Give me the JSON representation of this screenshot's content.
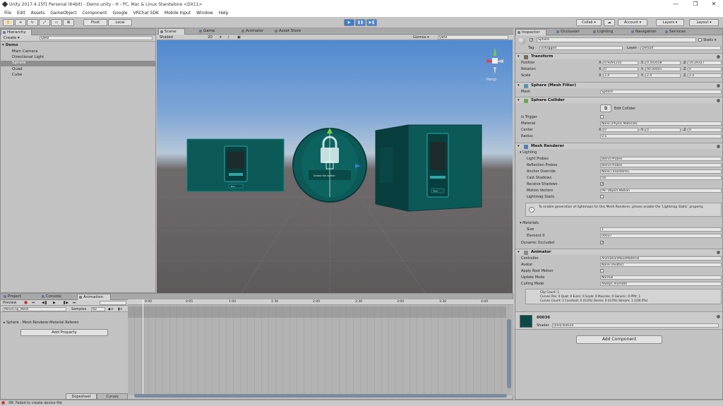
{
  "window": {
    "title": "Unity 2017.4.15f1 Personal (64bit) - Demo.unity - H - PC, Mac & Linux Standalone <DX11>",
    "controls": [
      "—",
      "❐",
      "✕"
    ]
  },
  "menu": [
    "File",
    "Edit",
    "Assets",
    "GameObject",
    "Component",
    "Google",
    "VRChat SDK",
    "Mobile Input",
    "Window",
    "Help"
  ],
  "toolbar": {
    "pivot": "Pivot",
    "local": "Local",
    "collab": "Collab ▾",
    "account": "Account ▾",
    "layers": "Layers ▾",
    "layout": "Layout ▾",
    "play_active": true,
    "accent": "#3d7bd4"
  },
  "hierarchy": {
    "tab": "Hierarchy",
    "create": "Create ▾",
    "search": "Q▾All",
    "scene_name": "Demo",
    "items": [
      "Main Camera",
      "Directional Light",
      "Sphere",
      "Quad",
      "Cube"
    ],
    "selected": "Sphere"
  },
  "scene_tabs": [
    "Scene",
    "Game",
    "Animator",
    "Asset Store"
  ],
  "scene_bar": {
    "shading": "Shaded",
    "mode": "2D",
    "gizmos": "Gizmos ▾",
    "search": "Q▾All",
    "persp": "Persp"
  },
  "scene_objects": {
    "panel_button": "Run",
    "screen_text": "Unlock the screen",
    "colors": {
      "teal": "#0b5a58",
      "teal_dark": "#083f3e",
      "glow": "#32c7c7"
    }
  },
  "bottom_tabs": [
    "Project",
    "Console",
    "Animation"
  ],
  "animation": {
    "preview": "Preview",
    "clip": "MoveClip_Mesh",
    "samples_label": "Samples",
    "samples": "60",
    "property": "Sphere : Mesh Renderer.Material Referen",
    "add_property": "Add Property",
    "ticks": [
      "0:00",
      "0:05",
      "1:00",
      "1:30",
      "2:00",
      "2:30",
      "3:00",
      "3:30",
      "4:00"
    ],
    "footer_tabs": [
      "Dopesheet",
      "Curves"
    ]
  },
  "status": {
    "message": "XR: Failed to create device file"
  },
  "inspector": {
    "tabs": [
      "Inspector",
      "Occlusion",
      "Lighting",
      "Navigation",
      "Services"
    ],
    "object_name": "Sphere",
    "static_label": "Static ▾",
    "tag_label": "Tag",
    "tag": "Untagged",
    "layer_label": "Layer",
    "layer": "Default",
    "transform": {
      "title": "Transform",
      "rows": [
        {
          "label": "Position",
          "x": "0.9291235",
          "y": "0.503558",
          "z": "10.29327"
        },
        {
          "label": "Rotation",
          "x": "0",
          "y": "90.00001",
          "z": "0"
        },
        {
          "label": "Scale",
          "x": "2.4",
          "y": "2.4",
          "z": "2.4"
        }
      ]
    },
    "mesh_filter": {
      "title": "Sphere (Mesh Filter)",
      "label": "Mesh",
      "value": "Sphere"
    },
    "collider": {
      "title": "Sphere Collider",
      "edit": "Edit Collider",
      "rows": [
        {
          "label": "Is Trigger",
          "value": ""
        },
        {
          "label": "Material",
          "value": "None (Physic Material)"
        },
        {
          "label": "Center",
          "x": "0",
          "y": "0",
          "z": "0"
        },
        {
          "label": "Radius",
          "value": "0.5"
        }
      ]
    },
    "renderer": {
      "title": "Mesh Renderer",
      "lighting": "Lighting",
      "rows": [
        {
          "label": "Light Probes",
          "value": "Blend Probes"
        },
        {
          "label": "Reflection Probes",
          "value": "Blend Probes"
        },
        {
          "label": "Anchor Override",
          "value": "None (Transform)"
        },
        {
          "label": "Cast Shadows",
          "value": "On"
        },
        {
          "label": "Receive Shadows",
          "value": "✓"
        },
        {
          "label": "Motion Vectors",
          "value": "Per Object Motion"
        },
        {
          "label": "Lightmap Static",
          "value": ""
        }
      ],
      "note": "To enable generation of lightmaps for this Mesh Renderer, please enable the 'Lightmap Static' property.",
      "materials": "Materials",
      "size_label": "Size",
      "size": "1",
      "element_label": "Element 0",
      "element": "00037",
      "dynamic": "Dynamic Occluded"
    },
    "animator": {
      "title": "Animator",
      "rows": [
        {
          "label": "Controller",
          "value": "AnimationMoveMaterial"
        },
        {
          "label": "Avatar",
          "value": "None (Avatar)"
        },
        {
          "label": "Apply Root Motion",
          "value": ""
        },
        {
          "label": "Update Mode",
          "value": "Normal"
        },
        {
          "label": "Culling Mode",
          "value": "Always Animate"
        }
      ],
      "info": [
        "Clip Count: 1",
        "Curves Pos: 0 Quat: 0 Euler: 0 Scale: 0 Muscles: 0 Generic: 0 PPtr: 1",
        "Curves Count: 1 Constant: 0 (0.0%) Dense: 0 (0.0%) Stream: 1 (100.0%)"
      ]
    },
    "material": {
      "name": "00036",
      "shader_label": "Shader",
      "shader": "Unlit/Texture"
    },
    "add_component": "Add Component"
  }
}
